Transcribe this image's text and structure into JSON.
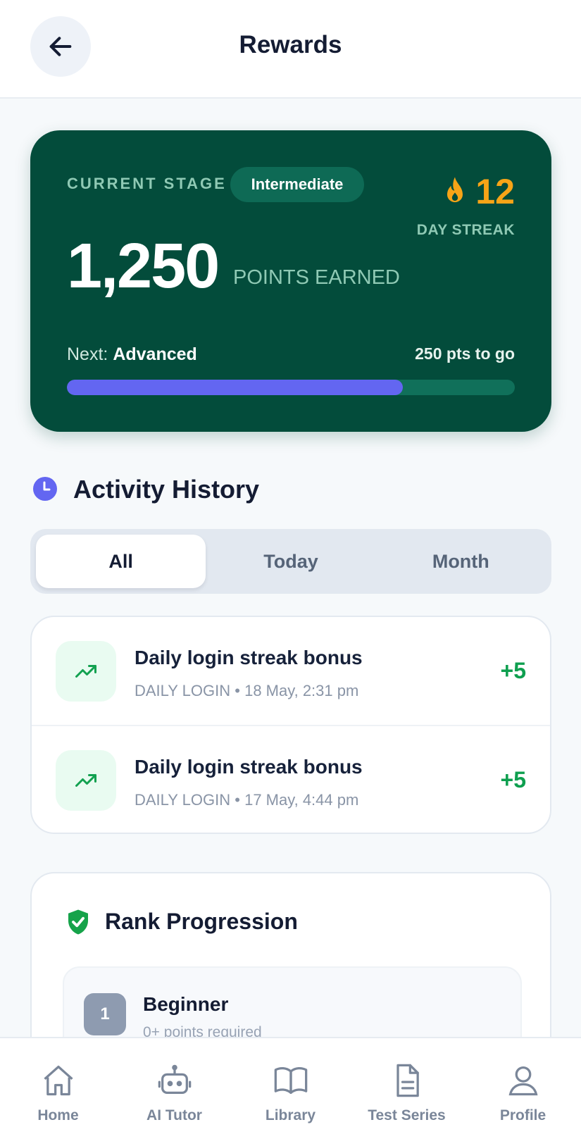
{
  "header": {
    "title": "Rewards",
    "back_icon": "arrow-left-icon"
  },
  "stage_card": {
    "stage_label": "CURRENT STAGE",
    "stage_badge": "Intermediate",
    "streak_icon": "flame-icon",
    "streak_count": "12",
    "streak_label": "DAY STREAK",
    "points_value": "1,250",
    "points_label": "POINTS EARNED",
    "next_prefix": "Next:",
    "next_stage": "Advanced",
    "pts_to_go": "250 pts to go",
    "progress_fraction": 0.75,
    "colors": {
      "card_bg": "#034c3b",
      "accent": "#6366f1",
      "streak": "#f7a417"
    }
  },
  "activity": {
    "section_icon": "clock-icon",
    "title": "Activity History",
    "tabs": [
      {
        "label": "All",
        "active": true
      },
      {
        "label": "Today",
        "active": false
      },
      {
        "label": "Month",
        "active": false
      }
    ],
    "items": [
      {
        "icon": "trending-up-icon",
        "title": "Daily login streak bonus",
        "category": "DAILY LOGIN",
        "separator": "•",
        "timestamp": "18 May, 2:31 pm",
        "points": "+5"
      },
      {
        "icon": "trending-up-icon",
        "title": "Daily login streak bonus",
        "category": "DAILY LOGIN",
        "separator": "•",
        "timestamp": "17 May, 4:44 pm",
        "points": "+5"
      }
    ]
  },
  "rank": {
    "section_icon": "shield-check-icon",
    "title": "Rank Progression",
    "items": [
      {
        "number": "1",
        "name": "Beginner",
        "requirement": "0+ points required"
      }
    ]
  },
  "bottom_nav": {
    "items": [
      {
        "label": "Home",
        "icon": "home-icon"
      },
      {
        "label": "AI Tutor",
        "icon": "robot-icon"
      },
      {
        "label": "Library",
        "icon": "book-icon"
      },
      {
        "label": "Test Series",
        "icon": "document-icon"
      },
      {
        "label": "Profile",
        "icon": "user-icon"
      }
    ]
  }
}
